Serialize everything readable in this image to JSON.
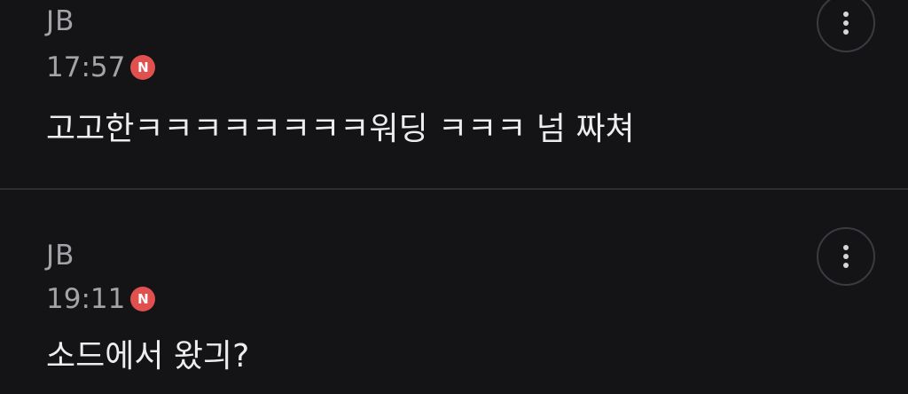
{
  "comments": [
    {
      "author": "JB",
      "time": "17:57",
      "badge": "N",
      "text": "고고한ㅋㅋㅋㅋㅋㅋㅋㅋ워딩 ㅋㅋㅋ 넘 짜쳐",
      "more_icon": "more-vertical-icon"
    },
    {
      "author": "JB",
      "time": "19:11",
      "badge": "N",
      "text": "소드에서 왔긔?",
      "more_icon": "more-vertical-icon"
    }
  ],
  "colors": {
    "background": "#141417",
    "author_text": "#a3a3a8",
    "body_text": "#ededf0",
    "new_badge": "#e0504f",
    "divider": "#2c2c31"
  }
}
